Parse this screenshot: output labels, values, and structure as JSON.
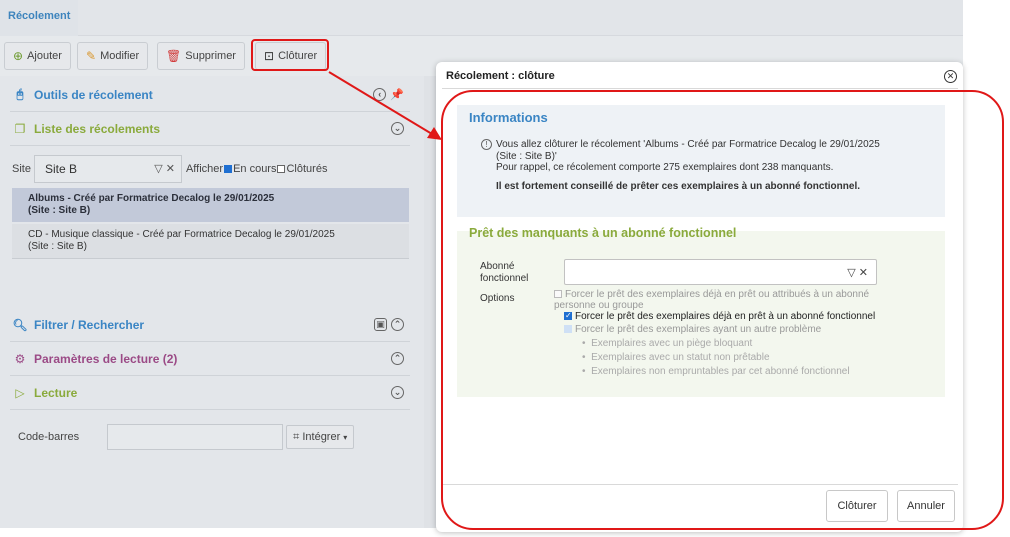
{
  "app": {
    "tab_label": "Récolement"
  },
  "toolbar": {
    "add_label": "Ajouter",
    "edit_label": "Modifier",
    "delete_label": "Supprimer",
    "close_label": "Clôturer"
  },
  "left": {
    "tools_title": "Outils de récolement",
    "list_title": "Liste des récolements",
    "site_label": "Site",
    "site_value": "Site B",
    "show_label": "Afficher",
    "in_progress_label": "En cours",
    "closed_label": "Clôturés",
    "items": [
      {
        "line1": "Albums - Créé par Formatrice Decalog le 29/01/2025",
        "line2": "(Site : Site B)"
      },
      {
        "line1": "CD - Musique classique - Créé par Formatrice Decalog le 29/01/2025",
        "line2": "(Site : Site B)"
      }
    ],
    "filter_title": "Filtrer / Rechercher",
    "params_title": "Paramètres de lecture (2)",
    "reading_title": "Lecture",
    "barcode_label": "Code-barres",
    "integrate_label": "Intégrer"
  },
  "colors": {
    "accent_blue": "#3a85c4",
    "accent_green": "#8aaa3c",
    "params_purple": "#9b4a86",
    "highlight_red": "#e01818"
  },
  "modal": {
    "title": "Récolement : clôture",
    "info_title": "Informations",
    "info_line1": "Vous allez clôturer le récolement 'Albums - Créé par Formatrice Decalog le 29/01/2025",
    "info_line2": "(Site : Site B)'",
    "info_line3": "Pour rappel, ce récolement comporte 275 exemplaires dont 238 manquants.",
    "info_warning": "Il est fortement conseillé de prêter ces exemplaires à un abonné fonctionnel.",
    "pret_title": "Prêt des manquants à un abonné fonctionnel",
    "abonne_label_1": "Abonné",
    "abonne_label_2": "fonctionnel",
    "options_label": "Options",
    "opt1_line1": "Forcer le prêt des exemplaires déjà en prêt ou attribués à un abonné",
    "opt1_line2": "personne ou groupe",
    "opt2": "Forcer le prêt des exemplaires déjà en prêt à un abonné fonctionnel",
    "opt3": "Forcer le prêt des exemplaires ayant un autre problème",
    "sub_options": [
      "Exemplaires avec un piège bloquant",
      "Exemplaires avec un statut non prêtable",
      "Exemplaires non empruntables par cet abonné fonctionnel"
    ],
    "confirm_label": "Clôturer",
    "cancel_label": "Annuler"
  }
}
